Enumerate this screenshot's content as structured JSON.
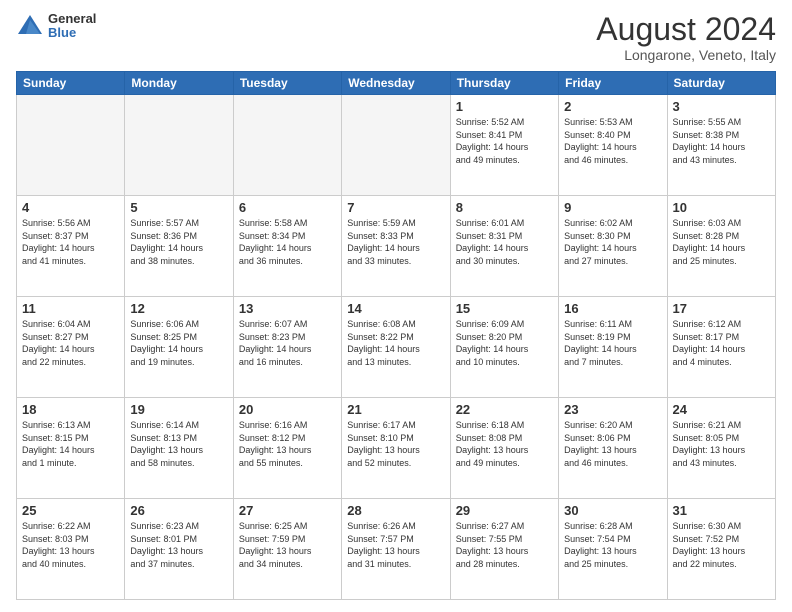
{
  "header": {
    "logo_general": "General",
    "logo_blue": "Blue",
    "title": "August 2024",
    "subtitle": "Longarone, Veneto, Italy"
  },
  "weekdays": [
    "Sunday",
    "Monday",
    "Tuesday",
    "Wednesday",
    "Thursday",
    "Friday",
    "Saturday"
  ],
  "weeks": [
    [
      {
        "day": "",
        "info": ""
      },
      {
        "day": "",
        "info": ""
      },
      {
        "day": "",
        "info": ""
      },
      {
        "day": "",
        "info": ""
      },
      {
        "day": "1",
        "info": "Sunrise: 5:52 AM\nSunset: 8:41 PM\nDaylight: 14 hours\nand 49 minutes."
      },
      {
        "day": "2",
        "info": "Sunrise: 5:53 AM\nSunset: 8:40 PM\nDaylight: 14 hours\nand 46 minutes."
      },
      {
        "day": "3",
        "info": "Sunrise: 5:55 AM\nSunset: 8:38 PM\nDaylight: 14 hours\nand 43 minutes."
      }
    ],
    [
      {
        "day": "4",
        "info": "Sunrise: 5:56 AM\nSunset: 8:37 PM\nDaylight: 14 hours\nand 41 minutes."
      },
      {
        "day": "5",
        "info": "Sunrise: 5:57 AM\nSunset: 8:36 PM\nDaylight: 14 hours\nand 38 minutes."
      },
      {
        "day": "6",
        "info": "Sunrise: 5:58 AM\nSunset: 8:34 PM\nDaylight: 14 hours\nand 36 minutes."
      },
      {
        "day": "7",
        "info": "Sunrise: 5:59 AM\nSunset: 8:33 PM\nDaylight: 14 hours\nand 33 minutes."
      },
      {
        "day": "8",
        "info": "Sunrise: 6:01 AM\nSunset: 8:31 PM\nDaylight: 14 hours\nand 30 minutes."
      },
      {
        "day": "9",
        "info": "Sunrise: 6:02 AM\nSunset: 8:30 PM\nDaylight: 14 hours\nand 27 minutes."
      },
      {
        "day": "10",
        "info": "Sunrise: 6:03 AM\nSunset: 8:28 PM\nDaylight: 14 hours\nand 25 minutes."
      }
    ],
    [
      {
        "day": "11",
        "info": "Sunrise: 6:04 AM\nSunset: 8:27 PM\nDaylight: 14 hours\nand 22 minutes."
      },
      {
        "day": "12",
        "info": "Sunrise: 6:06 AM\nSunset: 8:25 PM\nDaylight: 14 hours\nand 19 minutes."
      },
      {
        "day": "13",
        "info": "Sunrise: 6:07 AM\nSunset: 8:23 PM\nDaylight: 14 hours\nand 16 minutes."
      },
      {
        "day": "14",
        "info": "Sunrise: 6:08 AM\nSunset: 8:22 PM\nDaylight: 14 hours\nand 13 minutes."
      },
      {
        "day": "15",
        "info": "Sunrise: 6:09 AM\nSunset: 8:20 PM\nDaylight: 14 hours\nand 10 minutes."
      },
      {
        "day": "16",
        "info": "Sunrise: 6:11 AM\nSunset: 8:19 PM\nDaylight: 14 hours\nand 7 minutes."
      },
      {
        "day": "17",
        "info": "Sunrise: 6:12 AM\nSunset: 8:17 PM\nDaylight: 14 hours\nand 4 minutes."
      }
    ],
    [
      {
        "day": "18",
        "info": "Sunrise: 6:13 AM\nSunset: 8:15 PM\nDaylight: 14 hours\nand 1 minute."
      },
      {
        "day": "19",
        "info": "Sunrise: 6:14 AM\nSunset: 8:13 PM\nDaylight: 13 hours\nand 58 minutes."
      },
      {
        "day": "20",
        "info": "Sunrise: 6:16 AM\nSunset: 8:12 PM\nDaylight: 13 hours\nand 55 minutes."
      },
      {
        "day": "21",
        "info": "Sunrise: 6:17 AM\nSunset: 8:10 PM\nDaylight: 13 hours\nand 52 minutes."
      },
      {
        "day": "22",
        "info": "Sunrise: 6:18 AM\nSunset: 8:08 PM\nDaylight: 13 hours\nand 49 minutes."
      },
      {
        "day": "23",
        "info": "Sunrise: 6:20 AM\nSunset: 8:06 PM\nDaylight: 13 hours\nand 46 minutes."
      },
      {
        "day": "24",
        "info": "Sunrise: 6:21 AM\nSunset: 8:05 PM\nDaylight: 13 hours\nand 43 minutes."
      }
    ],
    [
      {
        "day": "25",
        "info": "Sunrise: 6:22 AM\nSunset: 8:03 PM\nDaylight: 13 hours\nand 40 minutes."
      },
      {
        "day": "26",
        "info": "Sunrise: 6:23 AM\nSunset: 8:01 PM\nDaylight: 13 hours\nand 37 minutes."
      },
      {
        "day": "27",
        "info": "Sunrise: 6:25 AM\nSunset: 7:59 PM\nDaylight: 13 hours\nand 34 minutes."
      },
      {
        "day": "28",
        "info": "Sunrise: 6:26 AM\nSunset: 7:57 PM\nDaylight: 13 hours\nand 31 minutes."
      },
      {
        "day": "29",
        "info": "Sunrise: 6:27 AM\nSunset: 7:55 PM\nDaylight: 13 hours\nand 28 minutes."
      },
      {
        "day": "30",
        "info": "Sunrise: 6:28 AM\nSunset: 7:54 PM\nDaylight: 13 hours\nand 25 minutes."
      },
      {
        "day": "31",
        "info": "Sunrise: 6:30 AM\nSunset: 7:52 PM\nDaylight: 13 hours\nand 22 minutes."
      }
    ]
  ]
}
